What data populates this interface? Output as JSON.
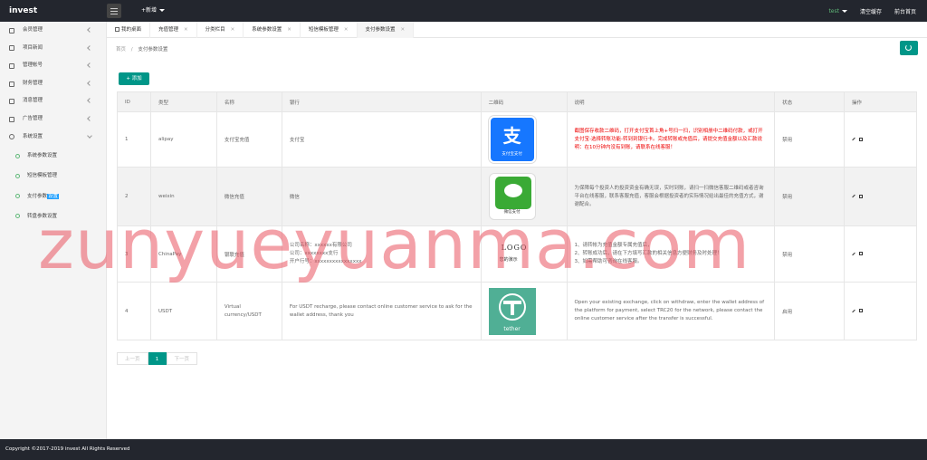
{
  "app": {
    "logo": "invest",
    "new_menu": "+新增"
  },
  "top_right": {
    "user": "test",
    "clear_cache": "清空缓存",
    "frontend": "前台首页"
  },
  "sidebar": {
    "items": [
      {
        "label": "会员管理"
      },
      {
        "label": "项目新闻"
      },
      {
        "label": "管理帐号"
      },
      {
        "label": "财务管理"
      },
      {
        "label": "消息管理"
      },
      {
        "label": "广告管理"
      },
      {
        "label": "系统设置"
      }
    ],
    "sub_items": [
      {
        "label": "系统参数设置",
        "hl": ""
      },
      {
        "label": "短信模板管理",
        "hl": ""
      },
      {
        "label": "支付参数",
        "hl": "设置"
      },
      {
        "label": "转盘参数设置",
        "hl": ""
      }
    ]
  },
  "tabs": [
    {
      "label": "我的桌面"
    },
    {
      "label": "充值管理"
    },
    {
      "label": "分类栏目"
    },
    {
      "label": "系统参数设置"
    },
    {
      "label": "短信模板管理"
    },
    {
      "label": "支付参数设置"
    }
  ],
  "breadcrumb": {
    "home": "首页",
    "sep": "/",
    "current": "支付参数设置"
  },
  "add_button": "添加",
  "table": {
    "headers": [
      "ID",
      "类型",
      "名称",
      "银行",
      "二维码",
      "说明",
      "状态",
      "操作"
    ],
    "rows": [
      {
        "id": "1",
        "type": "alipay",
        "name": "支付宝充值",
        "bank": "支付宝",
        "qr_caption": "支付宝支付",
        "desc": "截图保存收款二维码，打开支付宝首上角+号扫一扫，识别相册中二维码付款，或打开支付宝-选择转账功能-转到到银行卡。完成转账或充值后，请提交充值金额以及汇款说明：在10分钟内没有到账，请联系在线客服！",
        "status": "禁用"
      },
      {
        "id": "2",
        "type": "weixin",
        "name": "微信充值",
        "bank": "微信",
        "qr_caption": "微信支付",
        "desc": "为保障每个投资人的投资资金有确无误，实时到账，请扫一扫微信客服二维码或者咨询平台在线客服，联系客服充值，客服会根据投资者的实际情况给出最佳的充值方式，谢谢配合。",
        "status": "禁用"
      },
      {
        "id": "3",
        "type": "ChinaPay",
        "name": "银联充值",
        "bank_line1": "公司名称：xxxxxx有限公司",
        "bank_line2": "公司：xxxxxxxx支行",
        "bank_line3": "开户行号：xxxxxxxxxxxxxxxx",
        "logo_line1": "LOGO",
        "logo_line2": "您的演示",
        "desc_line1": "1、请转帐为充值金额专属充值后，",
        "desc_line2": "2、转账成功后，请在下方填写汇款的相关信息方便财务及时处理！",
        "desc_line3": "3、如需帮助可咨询在线客服。",
        "status": "禁用"
      },
      {
        "id": "4",
        "type": "USDT",
        "name": "Virtual currency/USDT",
        "bank": "For USDT recharge, please contact online customer service to ask for the wallet address, thank you",
        "qr_caption": "tether",
        "desc": "Open your existing exchange, click on withdraw, enter the wallet address of the platform for payment, select TRC20 for the network, please contact the online customer service after the transfer is successful.",
        "status": "启用"
      }
    ]
  },
  "pager": {
    "prev": "上一页",
    "page": "1",
    "next": "下一页"
  },
  "footer": "Copyright ©2017-2019 invest All Rights Reserved",
  "watermark": "zunyueyuanma.com",
  "colors": {
    "accent": "#009688",
    "topbar": "#23262e",
    "warning_text": "#e00000",
    "watermark": "#e95460"
  }
}
